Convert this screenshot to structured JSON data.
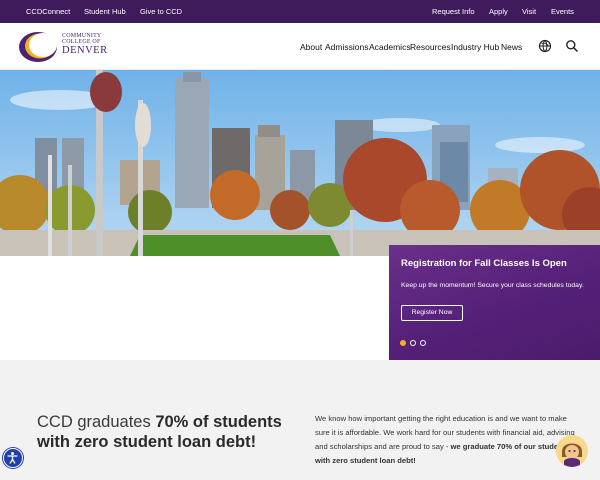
{
  "utility_bar": {
    "left_links": [
      "CCDConnect",
      "Student Hub",
      "Give to CCD"
    ],
    "right_links": [
      "Request Info",
      "Apply",
      "Visit",
      "Events"
    ]
  },
  "logo": {
    "line1": "COMMUNITY",
    "line2": "COLLEGE OF",
    "line3": "DENVER"
  },
  "nav": {
    "items": [
      "About",
      "Admissions",
      "Academics",
      "Resources",
      "Industry Hub",
      "News"
    ],
    "icons": [
      "globe-icon",
      "search-icon"
    ]
  },
  "promo": {
    "title": "Registration for Fall Classes Is Open",
    "text": "Keep up the momentum! Secure your class schedules today.",
    "button": "Register Now",
    "slide_count": 3,
    "active_slide": 1
  },
  "stats": {
    "headline_prefix": "CCD graduates ",
    "headline_bold": "70% of students with zero student loan debt!",
    "body_text": "We know how important getting the right education is and we want to make sure it is affordable. We work hard for our students with financial aid, advising and scholarships and are proud to say - ",
    "body_bold": "we graduate 70% of our students with zero student loan debt!"
  },
  "colors": {
    "brand_purple": "#3f1b5c",
    "promo_purple": "#5a2480",
    "accent_gold": "#f3b21e",
    "stats_background": "#f2f2f2"
  }
}
